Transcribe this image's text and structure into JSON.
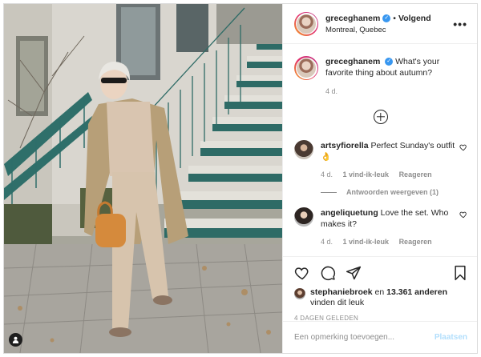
{
  "post": {
    "username": "greceghanem",
    "follow_label": "Volgend",
    "location": "Montreal, Quebec",
    "more_icon": "more-options-icon",
    "colors": {
      "verified": "#3897f0",
      "post_button_disabled": "#b2dffc",
      "muted_text": "#8e8e8e"
    }
  },
  "caption": {
    "username": "greceghanem",
    "text": "What's your favorite thing about autumn?",
    "time": "4 d."
  },
  "comments": [
    {
      "username": "artsyfiorella",
      "text": "Perfect Sunday's outfit 👌",
      "time": "4 d.",
      "likes": "1 vind-ik-leuk",
      "reply_label": "Reageren",
      "view_replies": "Antwoorden weergeven (1)"
    },
    {
      "username": "angeliquetung",
      "text": "Love the set. Who makes it?",
      "time": "4 d.",
      "likes": "1 vind-ik-leuk",
      "reply_label": "Reageren"
    }
  ],
  "likes": {
    "user": "stephaniebroek",
    "connector": "en",
    "count": "13.361 anderen",
    "suffix": "vinden dit leuk"
  },
  "timestamp": "4 DAGEN GELEDEN",
  "add_comment": {
    "placeholder": "Een opmerking toevoegen...",
    "post_label": "Plaatsen"
  }
}
